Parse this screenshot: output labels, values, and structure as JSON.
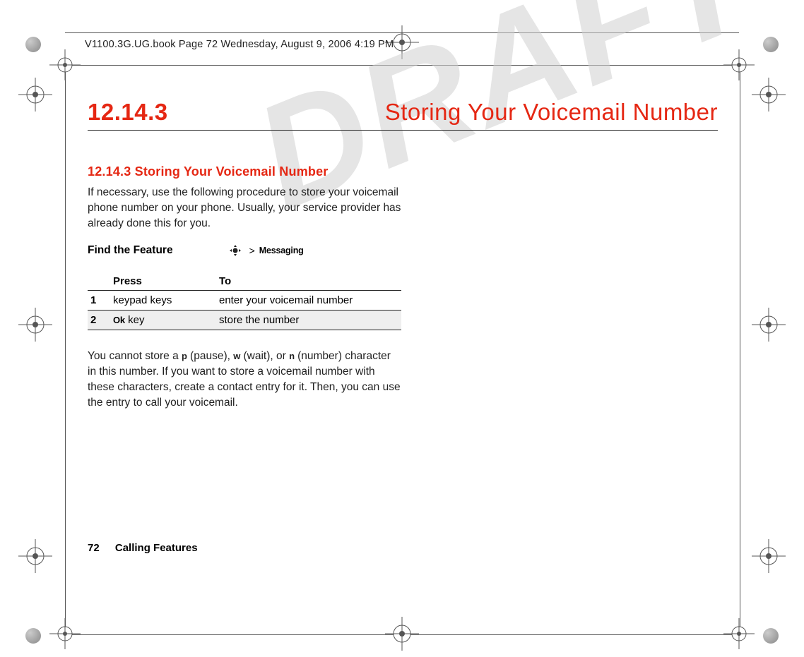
{
  "header_text": "V1100.3G.UG.book  Page 72  Wednesday, August 9, 2006  4:19 PM",
  "watermark": "DRAFT",
  "section": {
    "number": "12.14.3",
    "title": "Storing Your Voicemail Number"
  },
  "subsection_heading": "12.14.3 Storing Your Voicemail Number",
  "intro_paragraph": "If necessary, use the following procedure to store your voicemail phone number on your phone. Usually, your service provider has already done this for you.",
  "find_feature": {
    "label": "Find the Feature",
    "separator": ">",
    "menu": "Messaging"
  },
  "table": {
    "headers": {
      "col1": "Press",
      "col2": "To"
    },
    "rows": [
      {
        "num": "1",
        "press": "keypad keys",
        "press_key": "",
        "to": "enter your voicemail number"
      },
      {
        "num": "2",
        "press": " key",
        "press_key": "Ok",
        "to": "store the number"
      }
    ]
  },
  "note_paragraph": "You cannot store a p (pause), w (wait), or n (number) character in this number. If you want to store a voicemail number with these characters, create a contact entry for it. Then, you can use the entry to call your voicemail.",
  "note_keys": {
    "p": "p",
    "w": "w",
    "n": "n"
  },
  "footer": {
    "page": "72",
    "chapter": "Calling Features"
  }
}
